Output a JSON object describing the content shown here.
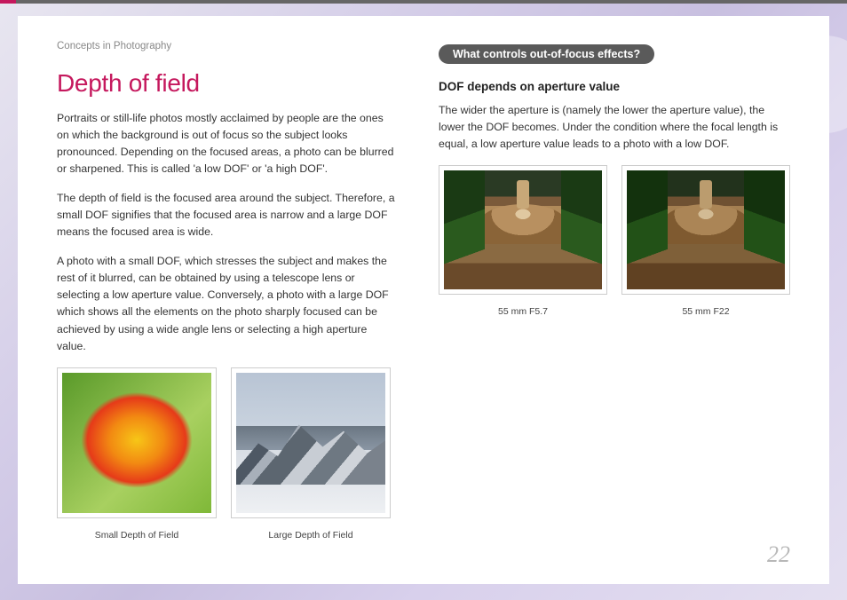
{
  "section_label": "Concepts in Photography",
  "title": "Depth of field",
  "left": {
    "p1": "Portraits or still-life photos mostly acclaimed by people are the ones on which the background is out of focus so the subject looks pronounced. Depending on the focused areas, a photo can be blurred or sharpened. This is called 'a low DOF' or 'a high DOF'.",
    "p2": "The depth of field is the focused area around the subject. Therefore, a small DOF signifies that the focused area is narrow and a large DOF means the focused area is wide.",
    "p3": "A photo with a small DOF, which stresses the subject and makes the rest of it blurred, can be obtained by using a telescope lens or selecting a low aperture value. Conversely, a photo with a large DOF which shows all the elements on the photo sharply focused can be achieved by using a wide angle lens or selecting a high aperture value.",
    "caption1": "Small Depth of Field",
    "caption2": "Large Depth of Field"
  },
  "right": {
    "pill": "What controls out-of-focus effects?",
    "subhead": "DOF depends on aperture value",
    "p1": "The wider the aperture is (namely the lower the aperture value), the lower the DOF becomes. Under the condition where the focal length is equal, a low aperture value leads to a photo with a low DOF.",
    "caption1": "55 mm F5.7",
    "caption2": "55 mm F22"
  },
  "page_number": "22"
}
